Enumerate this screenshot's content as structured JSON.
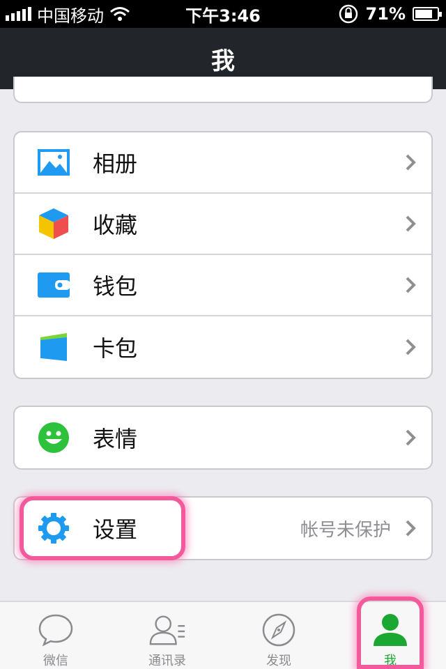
{
  "status_bar": {
    "carrier": "中国移动",
    "time": "下午3:46",
    "battery": "71%",
    "battery_level": 0.71
  },
  "nav": {
    "title": "我"
  },
  "groups": {
    "services": [
      {
        "label": "相册",
        "icon": "photo-album-icon"
      },
      {
        "label": "收藏",
        "icon": "favorites-cube-icon"
      },
      {
        "label": "钱包",
        "icon": "wallet-icon"
      },
      {
        "label": "卡包",
        "icon": "card-pack-icon"
      }
    ],
    "emoji": {
      "label": "表情",
      "icon": "smiley-icon"
    },
    "settings": {
      "label": "设置",
      "detail": "帐号未保护",
      "icon": "gear-icon"
    }
  },
  "tabs": [
    {
      "label": "微信",
      "icon": "chat-bubble-icon",
      "active": false
    },
    {
      "label": "通讯录",
      "icon": "contacts-icon",
      "active": false
    },
    {
      "label": "发现",
      "icon": "compass-icon",
      "active": false
    },
    {
      "label": "我",
      "icon": "me-person-icon",
      "active": true
    }
  ],
  "colors": {
    "nav_bg": "#222529",
    "accent_green": "#1aa832",
    "highlight_pink": "#f25a9c",
    "icon_blue": "#1e9bf0"
  }
}
